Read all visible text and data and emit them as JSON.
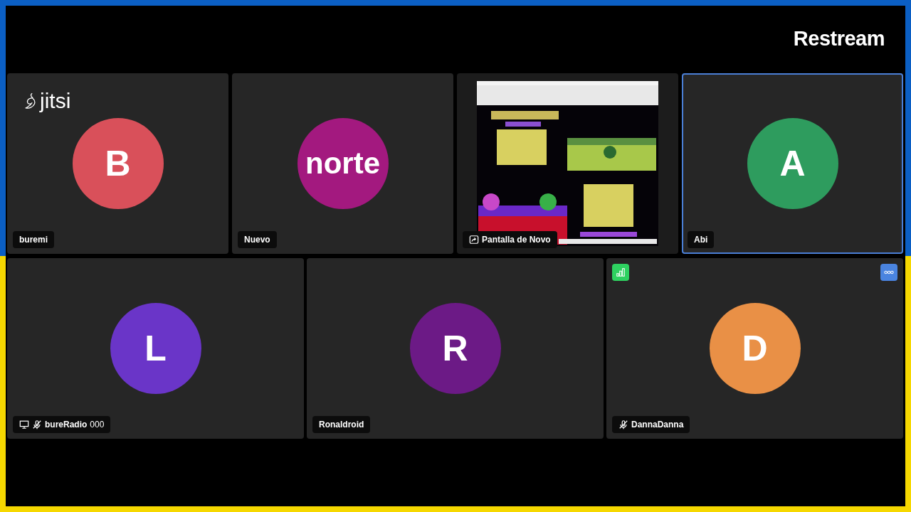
{
  "overlay_logo": "Restream",
  "rows": [
    {
      "tiles": [
        {
          "kind": "avatar",
          "initials": "B",
          "color": "#d9505a",
          "name": "buremi",
          "selected": false,
          "muted": false,
          "watermark": "jitsi"
        },
        {
          "kind": "avatar",
          "initials": "norte",
          "color": "#a3197f",
          "name": "Nuevo",
          "selected": false,
          "muted": false
        },
        {
          "kind": "screen",
          "name": "Pantalla de Novo",
          "selected": false,
          "muted": false
        },
        {
          "kind": "avatar",
          "initials": "A",
          "color": "#2e9c5e",
          "name": "Abi",
          "selected": true,
          "muted": false
        }
      ]
    },
    {
      "tiles": [
        {
          "kind": "avatar",
          "initials": "L",
          "color": "#6a35c8",
          "name": "bureRadio",
          "name_suffix": "000",
          "screen_icon": true,
          "selected": false,
          "muted": true
        },
        {
          "kind": "avatar",
          "initials": "R",
          "color": "#6c1a86",
          "name": "Ronaldroid",
          "selected": false,
          "muted": false
        },
        {
          "kind": "avatar",
          "initials": "D",
          "color": "#e99046",
          "name": "DannaDanna",
          "selected": false,
          "muted": true,
          "connection_indicator": true,
          "more_button": true
        }
      ]
    }
  ]
}
